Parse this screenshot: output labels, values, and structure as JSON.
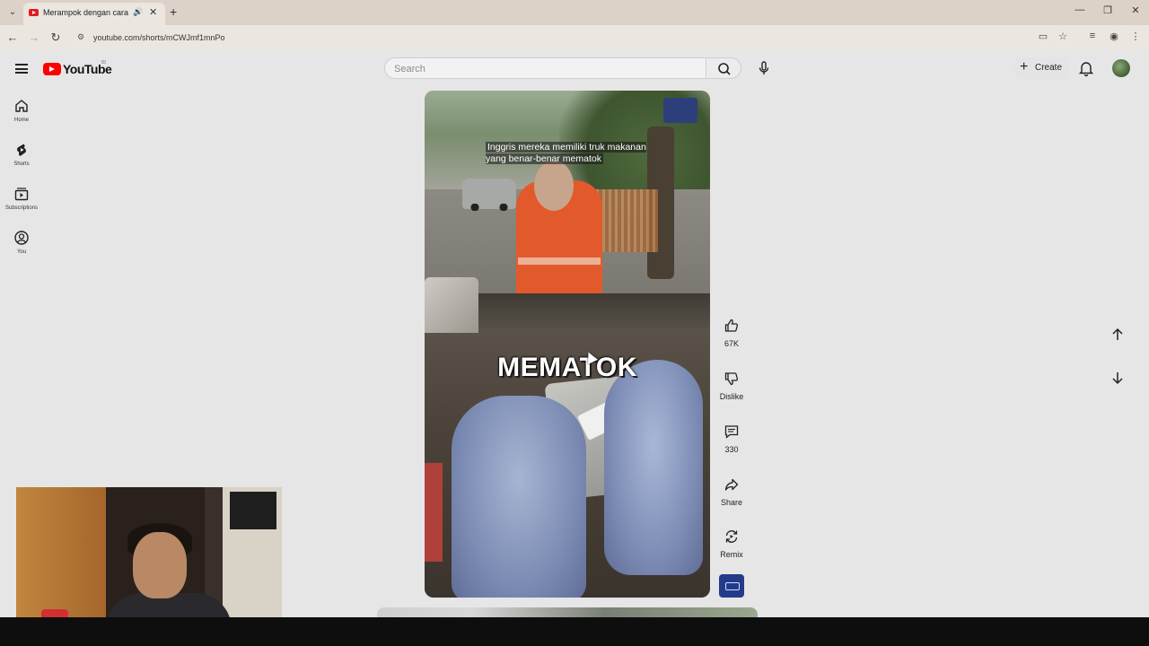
{
  "browser": {
    "tab": {
      "title": "Merampok dengan cara ya...",
      "favicon": "youtube-favicon",
      "audio_icon": "speaker-icon"
    },
    "url": "youtube.com/shorts/mCWJmf1mnPo"
  },
  "header": {
    "logo_text": "YouTube",
    "country_code": "ID",
    "search_placeholder": "Search",
    "create_label": "Create"
  },
  "guide": {
    "items": [
      {
        "label": "Home",
        "icon": "home-icon"
      },
      {
        "label": "Shorts",
        "icon": "shorts-icon"
      },
      {
        "label": "Subscriptions",
        "icon": "subscriptions-icon"
      },
      {
        "label": "You",
        "icon": "account-icon"
      }
    ]
  },
  "short": {
    "caption": "Inggris mereka memiliki truk makanan yang benar-benar mematok",
    "overlay_word": "MEMATOK"
  },
  "actions": {
    "like_count": "67K",
    "dislike_label": "Dislike",
    "comment_count": "330",
    "share_label": "Share",
    "remix_label": "Remix"
  },
  "colors": {
    "brand_red": "#ff0000",
    "background": "#e6e6e6"
  }
}
